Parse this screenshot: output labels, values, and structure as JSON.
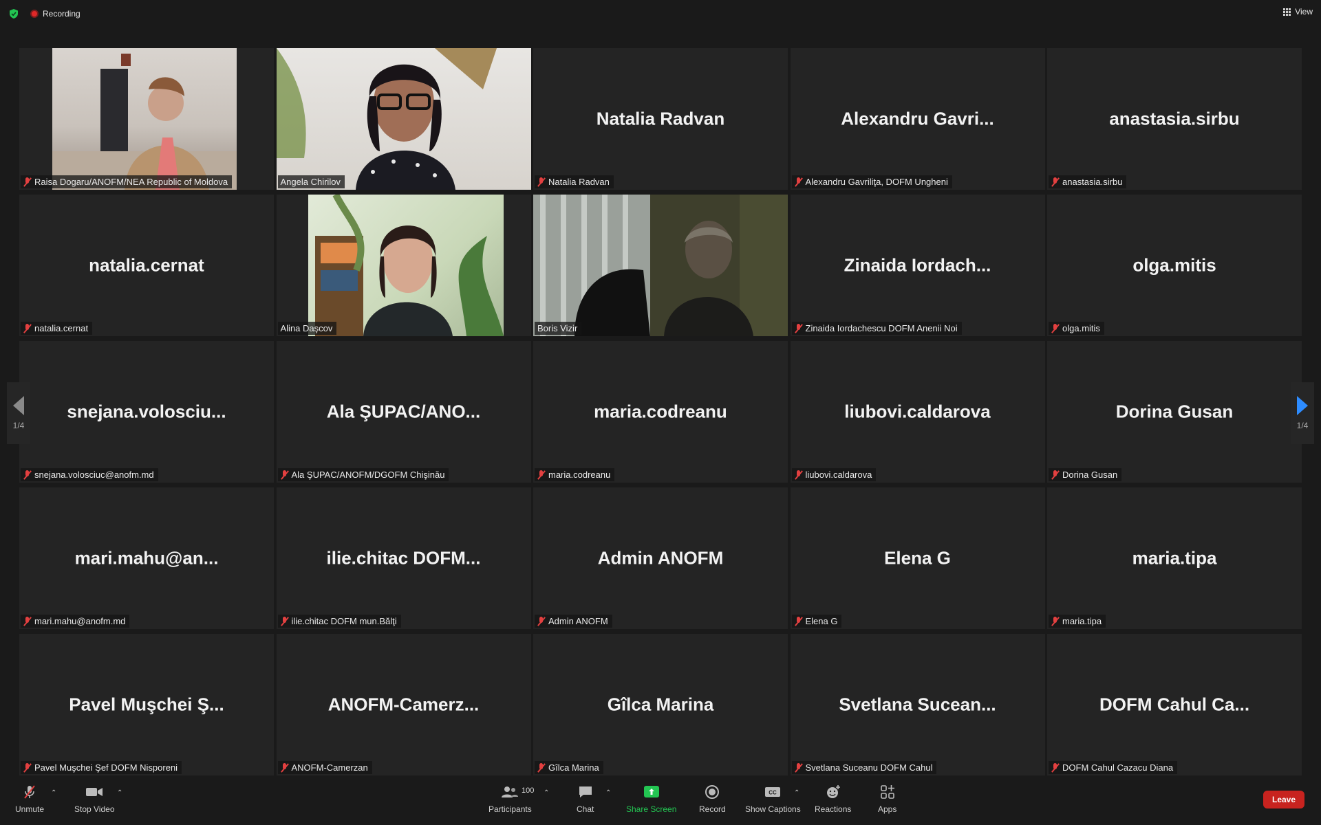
{
  "topbar": {
    "recording_label": "Recording",
    "view_label": "View"
  },
  "pager": {
    "left_page": "1/4",
    "right_page": "1/4"
  },
  "participants": [
    {
      "label": "Raisa Dogaru/ANOFM/NEA Republic of Moldova",
      "display": "",
      "video": true,
      "scene": "office-desk",
      "active": false
    },
    {
      "label": "Angela Chirilov",
      "display": "",
      "video": true,
      "scene": "woman-glasses",
      "active": false
    },
    {
      "label": "Natalia Radvan",
      "display": "Natalia Radvan",
      "video": false,
      "active": false
    },
    {
      "label": "Alexandru Gavriliţa, DOFM Ungheni",
      "display": "Alexandru  Gavri...",
      "video": false,
      "active": false
    },
    {
      "label": "anastasia.sirbu",
      "display": "anastasia.sirbu",
      "video": false,
      "active": false
    },
    {
      "label": "natalia.cernat",
      "display": "natalia.cernat",
      "video": false,
      "active": false
    },
    {
      "label": "Alina Daşcov",
      "display": "",
      "video": true,
      "scene": "woman-plants",
      "active": false
    },
    {
      "label": "Boris Vizir",
      "display": "",
      "video": true,
      "scene": "dark-room",
      "active": true
    },
    {
      "label": "Zinaida Iordachescu DOFM Anenii Noi",
      "display": "Zinaida  Iordach...",
      "video": false,
      "active": false
    },
    {
      "label": "olga.mitis",
      "display": "olga.mitis",
      "video": false,
      "active": false
    },
    {
      "label": "snejana.volosciuc@anofm.md",
      "display": "snejana.volosciu...",
      "video": false,
      "active": false
    },
    {
      "label": "Ala ŞUPAC/ANOFM/DGOFM Chişinău",
      "display": "Ala  ŞUPAC/ANO...",
      "video": false,
      "active": false
    },
    {
      "label": "maria.codreanu",
      "display": "maria.codreanu",
      "video": false,
      "active": false
    },
    {
      "label": "liubovi.caldarova",
      "display": "liubovi.caldarova",
      "video": false,
      "active": false
    },
    {
      "label": "Dorina Gusan",
      "display": "Dorina Gusan",
      "video": false,
      "active": false
    },
    {
      "label": "mari.mahu@anofm.md",
      "display": "mari.mahu@an...",
      "video": false,
      "active": false
    },
    {
      "label": "ilie.chitac DOFM mun.Bălţi",
      "display": "ilie.chitac  DOFM...",
      "video": false,
      "active": false
    },
    {
      "label": "Admin ANOFM",
      "display": "Admin ANOFM",
      "video": false,
      "active": false
    },
    {
      "label": "Elena G",
      "display": "Elena G",
      "video": false,
      "active": false
    },
    {
      "label": "maria.tipa",
      "display": "maria.tipa",
      "video": false,
      "active": false
    },
    {
      "label": "Pavel Muşchei Şef DOFM Nisporeni",
      "display": "Pavel  Muşchei  Ş...",
      "video": false,
      "active": false
    },
    {
      "label": "ANOFM-Camerzan",
      "display": "ANOFM-Camerz...",
      "video": false,
      "active": false
    },
    {
      "label": "Gîlca Marina",
      "display": "Gîlca Marina",
      "video": false,
      "active": false
    },
    {
      "label": "Svetlana Suceanu DOFM Cahul",
      "display": "Svetlana  Sucean...",
      "video": false,
      "active": false
    },
    {
      "label": "DOFM Cahul Cazacu Diana",
      "display": "DOFM Cahul Ca...",
      "video": false,
      "active": false
    }
  ],
  "toolbar": {
    "unmute": "Unmute",
    "stop_video": "Stop Video",
    "participants": "Participants",
    "participant_count": "100",
    "chat": "Chat",
    "share_screen": "Share Screen",
    "record": "Record",
    "show_captions": "Show Captions",
    "reactions": "Reactions",
    "apps": "Apps",
    "leave": "Leave"
  },
  "colors": {
    "active_border": "#e8eba0",
    "share_green": "#23c552",
    "leave_red": "#c8231f",
    "muted_red": "#e34040"
  }
}
